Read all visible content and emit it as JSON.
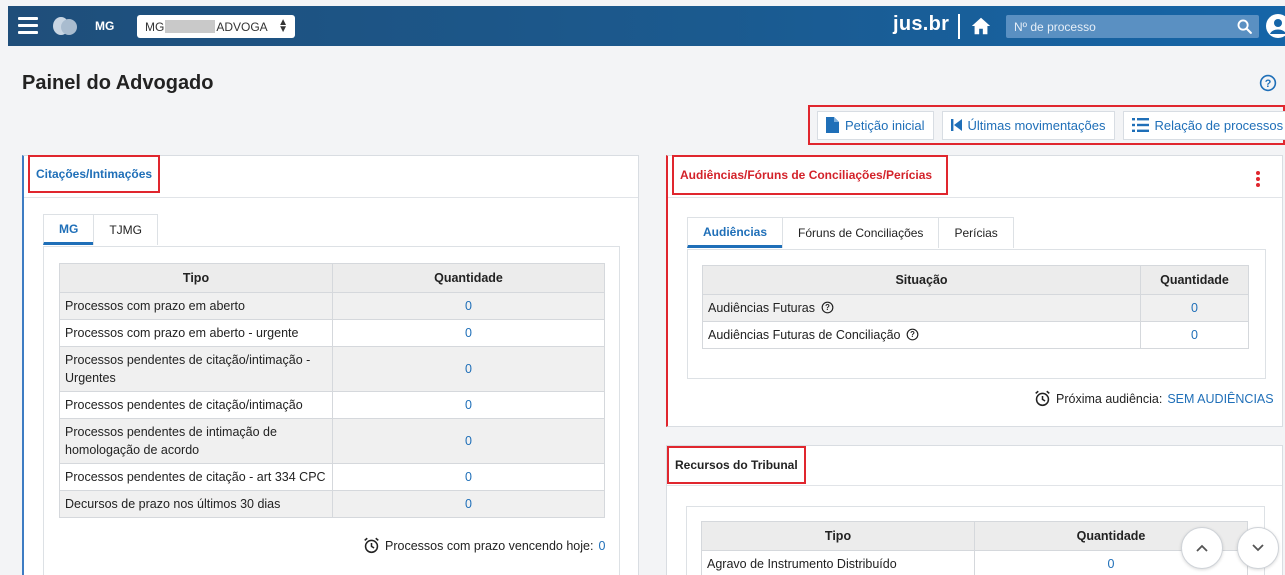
{
  "topbar": {
    "state": "MG",
    "profile_prefix": "MG",
    "profile_suffix": "ADVOGA",
    "brand": "jus.br",
    "search_placeholder": "Nº de processo"
  },
  "page": {
    "title": "Painel do Advogado"
  },
  "actions": [
    {
      "label": "Petição inicial",
      "icon": "document-icon"
    },
    {
      "label": "Últimas movimentações",
      "icon": "skip-back-icon"
    },
    {
      "label": "Relação de processos",
      "icon": "list-icon"
    }
  ],
  "citacoes": {
    "title": "Citações/Intimações",
    "tabs": [
      "MG",
      "TJMG"
    ],
    "columns": [
      "Tipo",
      "Quantidade"
    ],
    "rows": [
      {
        "tipo": "Processos com prazo em aberto",
        "qtd": "0"
      },
      {
        "tipo": "Processos com prazo em aberto - urgente",
        "qtd": "0"
      },
      {
        "tipo": "Processos pendentes de citação/intimação - Urgentes",
        "qtd": "0"
      },
      {
        "tipo": "Processos pendentes de citação/intimação",
        "qtd": "0"
      },
      {
        "tipo": "Processos pendentes de intimação de homologação de acordo",
        "qtd": "0"
      },
      {
        "tipo": "Processos pendentes de citação - art 334 CPC",
        "qtd": "0"
      },
      {
        "tipo": "Decursos de prazo nos últimos 30 dias",
        "qtd": "0"
      }
    ],
    "footer_label": "Processos com prazo vencendo hoje:",
    "footer_value": "0"
  },
  "audiencias": {
    "title": "Audiências/Fóruns de Conciliações/Perícias",
    "tabs": [
      "Audiências",
      "Fóruns de Conciliações",
      "Perícias"
    ],
    "columns": [
      "Situação",
      "Quantidade"
    ],
    "rows": [
      {
        "situacao": "Audiências Futuras",
        "qtd": "0"
      },
      {
        "situacao": "Audiências Futuras de Conciliação",
        "qtd": "0"
      }
    ],
    "footer_label": "Próxima audiência:",
    "footer_value": "SEM AUDIÊNCIAS"
  },
  "recursos": {
    "title": "Recursos do Tribunal",
    "columns": [
      "Tipo",
      "Quantidade"
    ],
    "rows": [
      {
        "tipo": "Agravo de Instrumento Distribuído",
        "qtd": "0"
      }
    ]
  },
  "colors": {
    "accent": "#1f6fb8",
    "highlight": "#e0262e",
    "topbar": "#1b5a8f"
  }
}
